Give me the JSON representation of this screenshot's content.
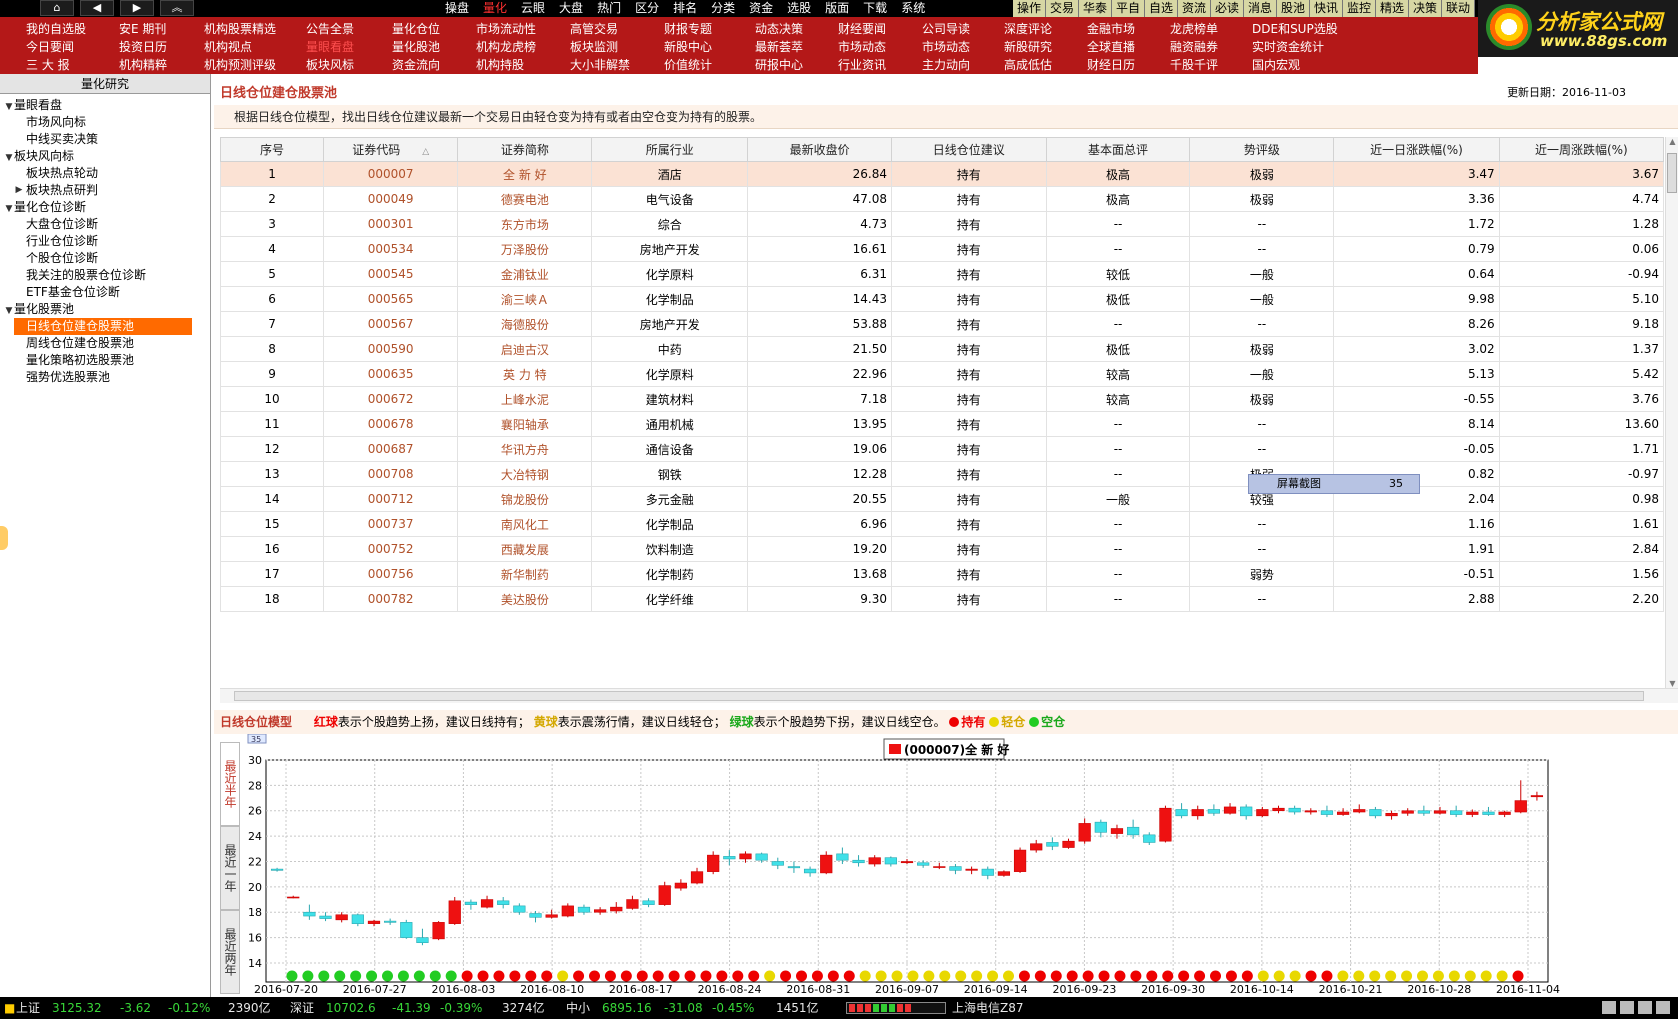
{
  "topbar": {
    "nav": [
      "⌂",
      "◀",
      "▶",
      "︽"
    ],
    "menu": [
      {
        "label": "操盘",
        "active": false
      },
      {
        "label": "量化",
        "active": true
      },
      {
        "label": "云眼",
        "active": false
      },
      {
        "label": "大盘",
        "active": false
      },
      {
        "label": "热门",
        "active": false
      },
      {
        "label": "区分",
        "active": false
      },
      {
        "label": "排名",
        "active": false
      },
      {
        "label": "分类",
        "active": false
      },
      {
        "label": "资金",
        "active": false
      },
      {
        "label": "选股",
        "active": false
      },
      {
        "label": "版面",
        "active": false
      },
      {
        "label": "下载",
        "active": false
      },
      {
        "label": "系统",
        "active": false
      }
    ],
    "tabs": [
      {
        "label": "操作",
        "hl": false
      },
      {
        "label": "交易",
        "hl": false
      },
      {
        "label": "华泰",
        "hl": false
      },
      {
        "label": "平自",
        "hl": false
      },
      {
        "label": "自选",
        "hl": false
      },
      {
        "label": "资流",
        "hl": false
      },
      {
        "label": "必读",
        "hl": false
      },
      {
        "label": "消息",
        "hl": false
      },
      {
        "label": "股池",
        "hl": false
      },
      {
        "label": "快讯",
        "hl": false
      },
      {
        "label": "监控",
        "hl": false
      },
      {
        "label": "精选",
        "hl": false
      },
      {
        "label": "决策",
        "hl": false
      },
      {
        "label": "联动",
        "hl": false
      }
    ]
  },
  "rednav": [
    {
      "items": [
        "我的自选股",
        "今日要闻",
        "三 大 报"
      ]
    },
    {
      "items": [
        "安E 期刊",
        "投资日历",
        "机构精粹"
      ]
    },
    {
      "items": [
        "机构股票精选",
        "机构视点",
        "机构预测评级"
      ]
    },
    {
      "items": [
        "公告全景",
        "量眼看盘",
        "板块风标"
      ],
      "active": 1
    },
    {
      "items": [
        "量化仓位",
        "量化股池",
        "资金流向"
      ]
    },
    {
      "items": [
        "市场流动性",
        "机构龙虎榜",
        "机构持股"
      ]
    },
    {
      "items": [
        "高管交易",
        "板块监测",
        "大小非解禁"
      ]
    },
    {
      "items": [
        "财报专题",
        "新股中心",
        "价值统计"
      ]
    },
    {
      "items": [
        "动态决策",
        "最新荟萃",
        "研报中心"
      ]
    },
    {
      "items": [
        "财经要闻",
        "市场动态",
        "行业资讯"
      ]
    },
    {
      "items": [
        "公司导读",
        "市场动态",
        "主力动向"
      ]
    },
    {
      "items": [
        "深度评论",
        "新股研究",
        "高成低估"
      ]
    },
    {
      "items": [
        "金融市场",
        "全球直播",
        "财经日历"
      ]
    },
    {
      "items": [
        "龙虎榜单",
        "融资融券",
        "千股千评"
      ]
    },
    {
      "items": [
        "DDE和SUP选股",
        "实时资金统计",
        "国内宏观"
      ]
    }
  ],
  "logo": {
    "name": "分析家公式网",
    "url": "www.88gs.com"
  },
  "sidebar": {
    "title": "量化研究",
    "nodes": [
      {
        "label": "量眼看盘",
        "lvl": 0,
        "tog": "▼"
      },
      {
        "label": "市场风向标",
        "lvl": 1
      },
      {
        "label": "中线买卖决策",
        "lvl": 1
      },
      {
        "label": "板块风向标",
        "lvl": 0,
        "tog": "▼"
      },
      {
        "label": "板块热点轮动",
        "lvl": 1
      },
      {
        "label": "板块热点研判",
        "lvl": 1,
        "tog": "▶"
      },
      {
        "label": "量化仓位诊断",
        "lvl": 0,
        "tog": "▼"
      },
      {
        "label": "大盘仓位诊断",
        "lvl": 1
      },
      {
        "label": "行业仓位诊断",
        "lvl": 1
      },
      {
        "label": "个股仓位诊断",
        "lvl": 1
      },
      {
        "label": "我关注的股票仓位诊断",
        "lvl": 1
      },
      {
        "label": "ETF基金仓位诊断",
        "lvl": 1
      },
      {
        "label": "量化股票池",
        "lvl": 0,
        "tog": "▼"
      },
      {
        "label": "日线仓位建仓股票池",
        "lvl": 1,
        "sel": true
      },
      {
        "label": "周线仓位建仓股票池",
        "lvl": 1
      },
      {
        "label": "量化策略初选股票池",
        "lvl": 1
      },
      {
        "label": "强势优选股票池",
        "lvl": 1
      }
    ]
  },
  "main": {
    "title": "日线仓位建仓股票池",
    "update": "更新日期：2016-11-03",
    "desc": "根据日线仓位模型，找出日线仓位建议最新一个交易日由轻仓变为持有或者由空仓变为持有的股票。",
    "columns": [
      "序号",
      "证券代码",
      "证券简称",
      "所属行业",
      "最新收盘价",
      "日线仓位建议",
      "基本面总评",
      "势评级",
      "近一日涨跌幅(%)",
      "近一周涨跌幅(%)"
    ],
    "sort_mark": "△",
    "rows": [
      [
        "1",
        "000007",
        "全 新 好",
        "酒店",
        "26.84",
        "持有",
        "极高",
        "极弱",
        "3.47",
        "3.67"
      ],
      [
        "2",
        "000049",
        "德赛电池",
        "电气设备",
        "47.08",
        "持有",
        "极高",
        "极弱",
        "3.36",
        "4.74"
      ],
      [
        "3",
        "000301",
        "东方市场",
        "综合",
        "4.73",
        "持有",
        "--",
        "--",
        "1.72",
        "1.28"
      ],
      [
        "4",
        "000534",
        "万泽股份",
        "房地产开发",
        "16.61",
        "持有",
        "--",
        "--",
        "0.79",
        "0.06"
      ],
      [
        "5",
        "000545",
        "金浦钛业",
        "化学原料",
        "6.31",
        "持有",
        "较低",
        "一般",
        "0.64",
        "-0.94"
      ],
      [
        "6",
        "000565",
        "渝三峡Ａ",
        "化学制品",
        "14.43",
        "持有",
        "极低",
        "一般",
        "9.98",
        "5.10"
      ],
      [
        "7",
        "000567",
        "海德股份",
        "房地产开发",
        "53.88",
        "持有",
        "--",
        "--",
        "8.26",
        "9.18"
      ],
      [
        "8",
        "000590",
        "启迪古汉",
        "中药",
        "21.50",
        "持有",
        "极低",
        "极弱",
        "3.02",
        "1.37"
      ],
      [
        "9",
        "000635",
        "英 力 特",
        "化学原料",
        "22.96",
        "持有",
        "较高",
        "一般",
        "5.13",
        "5.42"
      ],
      [
        "10",
        "000672",
        "上峰水泥",
        "建筑材料",
        "7.18",
        "持有",
        "较高",
        "极弱",
        "-0.55",
        "3.76"
      ],
      [
        "11",
        "000678",
        "襄阳轴承",
        "通用机械",
        "13.95",
        "持有",
        "--",
        "--",
        "8.14",
        "13.60"
      ],
      [
        "12",
        "000687",
        "华讯方舟",
        "通信设备",
        "19.06",
        "持有",
        "--",
        "--",
        "-0.05",
        "1.71"
      ],
      [
        "13",
        "000708",
        "大冶特钢",
        "钢铁",
        "12.28",
        "持有",
        "--",
        "极弱",
        "0.82",
        "-0.97"
      ],
      [
        "14",
        "000712",
        "锦龙股份",
        "多元金融",
        "20.55",
        "持有",
        "一般",
        "较强",
        "2.04",
        "0.98"
      ],
      [
        "15",
        "000737",
        "南风化工",
        "化学制品",
        "6.96",
        "持有",
        "--",
        "--",
        "1.16",
        "1.61"
      ],
      [
        "16",
        "000752",
        "西藏发展",
        "饮料制造",
        "19.20",
        "持有",
        "--",
        "--",
        "1.91",
        "2.84"
      ],
      [
        "17",
        "000756",
        "新华制药",
        "化学制药",
        "13.68",
        "持有",
        "--",
        "弱势",
        "-0.51",
        "1.56"
      ],
      [
        "18",
        "000782",
        "美达股份",
        "化学纤维",
        "9.30",
        "持有",
        "--",
        "--",
        "2.88",
        "2.20"
      ]
    ],
    "selected_row": 0
  },
  "tooltip": {
    "label": "屏幕截图",
    "count": "35"
  },
  "model_bar": {
    "title": "日线仓位模型",
    "red_ball": "红球",
    "red_text": "表示个股趋势上扬，建议日线持有；",
    "yellow_ball": "黄球",
    "yellow_text": "表示震荡行情，建议日线轻仓；",
    "green_ball": "绿球",
    "green_text": "表示个股趋势下拐，建议日线空仓。",
    "legend_hold": "持有",
    "legend_light": "轻仓",
    "legend_empty": "空仓",
    "colors": {
      "red": "#ee0000",
      "yellow": "#e8d800",
      "green": "#22cc22"
    }
  },
  "chart_tabs": [
    "最近半年",
    "最近一年",
    "最近两年"
  ],
  "chart_data": {
    "type": "candlestick",
    "legend": "(000007)全 新 好",
    "tag": "35",
    "ylim": [
      12.5,
      30
    ],
    "yticks": [
      14,
      16,
      18,
      20,
      22,
      24,
      26,
      28,
      30
    ],
    "xlabels": [
      "2016-07-20",
      "2016-07-27",
      "2016-08-03",
      "2016-08-10",
      "2016-08-17",
      "2016-08-24",
      "2016-08-31",
      "2016-09-07",
      "2016-09-14",
      "2016-09-23",
      "2016-09-30",
      "2016-10-14",
      "2016-10-21",
      "2016-10-28",
      "2016-11-04"
    ],
    "colors": {
      "up": "#ee1111",
      "down": "#3fe0e8",
      "grid": "#c8c8c8"
    },
    "candles": [
      [
        21.4,
        21.5,
        21.2,
        21.3
      ],
      [
        19.2,
        19.3,
        19.1,
        19.2
      ],
      [
        18.0,
        18.6,
        17.4,
        17.7
      ],
      [
        17.7,
        18.0,
        17.3,
        17.5
      ],
      [
        17.4,
        18.0,
        17.2,
        17.8
      ],
      [
        17.8,
        17.9,
        16.9,
        17.1
      ],
      [
        17.1,
        17.4,
        16.9,
        17.3
      ],
      [
        17.3,
        17.5,
        17.0,
        17.2
      ],
      [
        17.2,
        17.4,
        15.9,
        16.0
      ],
      [
        16.0,
        16.7,
        15.4,
        15.6
      ],
      [
        15.9,
        17.3,
        15.8,
        17.2
      ],
      [
        17.1,
        19.2,
        17.0,
        18.9
      ],
      [
        18.8,
        19.0,
        18.2,
        18.6
      ],
      [
        18.4,
        19.3,
        18.3,
        19.0
      ],
      [
        18.9,
        19.2,
        18.3,
        18.6
      ],
      [
        18.5,
        18.7,
        17.8,
        18.0
      ],
      [
        17.9,
        18.1,
        17.2,
        17.6
      ],
      [
        17.6,
        18.2,
        17.5,
        17.8
      ],
      [
        17.7,
        18.7,
        17.6,
        18.5
      ],
      [
        18.4,
        18.6,
        17.8,
        18.0
      ],
      [
        18.0,
        18.4,
        17.8,
        18.2
      ],
      [
        18.1,
        18.8,
        17.9,
        18.4
      ],
      [
        18.3,
        19.3,
        18.2,
        19.0
      ],
      [
        18.9,
        19.1,
        18.4,
        18.6
      ],
      [
        18.6,
        20.4,
        18.5,
        20.1
      ],
      [
        19.9,
        20.6,
        19.7,
        20.3
      ],
      [
        20.3,
        21.5,
        20.2,
        21.2
      ],
      [
        21.2,
        22.8,
        21.0,
        22.5
      ],
      [
        22.4,
        22.9,
        21.7,
        22.2
      ],
      [
        22.2,
        22.8,
        21.9,
        22.6
      ],
      [
        22.6,
        22.7,
        21.9,
        22.1
      ],
      [
        22.0,
        22.3,
        21.4,
        21.7
      ],
      [
        21.6,
        22.0,
        21.1,
        21.5
      ],
      [
        21.4,
        21.6,
        20.8,
        21.1
      ],
      [
        21.1,
        22.8,
        21.0,
        22.5
      ],
      [
        22.6,
        23.1,
        21.8,
        22.1
      ],
      [
        22.1,
        22.5,
        21.6,
        21.9
      ],
      [
        21.8,
        22.5,
        21.6,
        22.3
      ],
      [
        22.3,
        22.4,
        21.6,
        21.8
      ],
      [
        21.9,
        22.2,
        21.8,
        22.0
      ],
      [
        21.9,
        22.1,
        21.5,
        21.7
      ],
      [
        21.6,
        21.9,
        21.4,
        21.6
      ],
      [
        21.6,
        21.8,
        21.0,
        21.3
      ],
      [
        21.3,
        21.6,
        21.0,
        21.4
      ],
      [
        21.4,
        21.6,
        20.6,
        20.9
      ],
      [
        20.9,
        21.3,
        20.8,
        21.2
      ],
      [
        21.2,
        23.1,
        21.1,
        22.9
      ],
      [
        22.9,
        23.7,
        22.7,
        23.4
      ],
      [
        23.5,
        23.9,
        22.9,
        23.2
      ],
      [
        23.1,
        23.8,
        23.0,
        23.6
      ],
      [
        23.6,
        25.4,
        23.4,
        25.0
      ],
      [
        25.1,
        25.3,
        23.9,
        24.3
      ],
      [
        24.2,
        24.9,
        23.8,
        24.6
      ],
      [
        24.7,
        25.3,
        23.8,
        24.1
      ],
      [
        24.1,
        24.3,
        23.3,
        23.5
      ],
      [
        23.6,
        26.4,
        23.5,
        26.2
      ],
      [
        26.1,
        26.6,
        25.4,
        25.6
      ],
      [
        25.6,
        26.4,
        25.3,
        26.1
      ],
      [
        26.1,
        26.5,
        25.6,
        25.8
      ],
      [
        25.8,
        26.6,
        25.7,
        26.3
      ],
      [
        26.3,
        26.5,
        25.3,
        25.6
      ],
      [
        25.6,
        26.3,
        25.5,
        26.1
      ],
      [
        26.0,
        26.4,
        25.8,
        26.2
      ],
      [
        26.2,
        26.4,
        25.7,
        25.9
      ],
      [
        25.9,
        26.2,
        25.7,
        26.0
      ],
      [
        26.0,
        26.4,
        25.5,
        25.7
      ],
      [
        25.7,
        26.2,
        25.6,
        25.9
      ],
      [
        25.9,
        26.5,
        25.8,
        26.1
      ],
      [
        26.1,
        26.3,
        25.4,
        25.6
      ],
      [
        25.6,
        26.0,
        25.3,
        25.8
      ],
      [
        25.8,
        26.2,
        25.6,
        26.0
      ],
      [
        26.0,
        26.4,
        25.6,
        25.8
      ],
      [
        25.8,
        26.3,
        25.7,
        26.0
      ],
      [
        26.0,
        26.4,
        25.5,
        25.7
      ],
      [
        25.7,
        26.1,
        25.5,
        25.9
      ],
      [
        25.9,
        26.3,
        25.6,
        25.7
      ],
      [
        25.7,
        26.0,
        25.5,
        25.9
      ],
      [
        25.9,
        28.4,
        25.8,
        26.8
      ],
      [
        27.1,
        27.5,
        26.8,
        27.2
      ]
    ],
    "balls": [
      "g",
      "g",
      "g",
      "g",
      "g",
      "g",
      "g",
      "g",
      "g",
      "g",
      "g",
      "r",
      "r",
      "r",
      "r",
      "r",
      "r",
      "y",
      "r",
      "r",
      "r",
      "r",
      "r",
      "r",
      "r",
      "r",
      "r",
      "r",
      "r",
      "r",
      "y",
      "r",
      "r",
      "r",
      "r",
      "r",
      "y",
      "y",
      "y",
      "y",
      "y",
      "y",
      "y",
      "y",
      "y",
      "y",
      "r",
      "r",
      "r",
      "r",
      "r",
      "r",
      "r",
      "r",
      "r",
      "r",
      "r",
      "r",
      "r",
      "r",
      "r",
      "y",
      "y",
      "y",
      "r",
      "r",
      "y",
      "y",
      "y",
      "y",
      "y",
      "y",
      "y",
      "y",
      "y",
      "y",
      "y",
      "r"
    ]
  },
  "status": {
    "sh": {
      "name": "上证",
      "value": "3125.32",
      "chg": "-3.62",
      "pct": "-0.12%",
      "vol": "2390亿"
    },
    "sz": {
      "name": "深证",
      "value": "10702.6",
      "chg": "-41.39",
      "pct": "-0.39%",
      "vol": "3274亿"
    },
    "zx": {
      "name": "中小",
      "value": "6895.16",
      "chg": "-31.08",
      "pct": "-0.45%",
      "vol": "1451亿"
    },
    "isp": "上海电信Z87"
  }
}
